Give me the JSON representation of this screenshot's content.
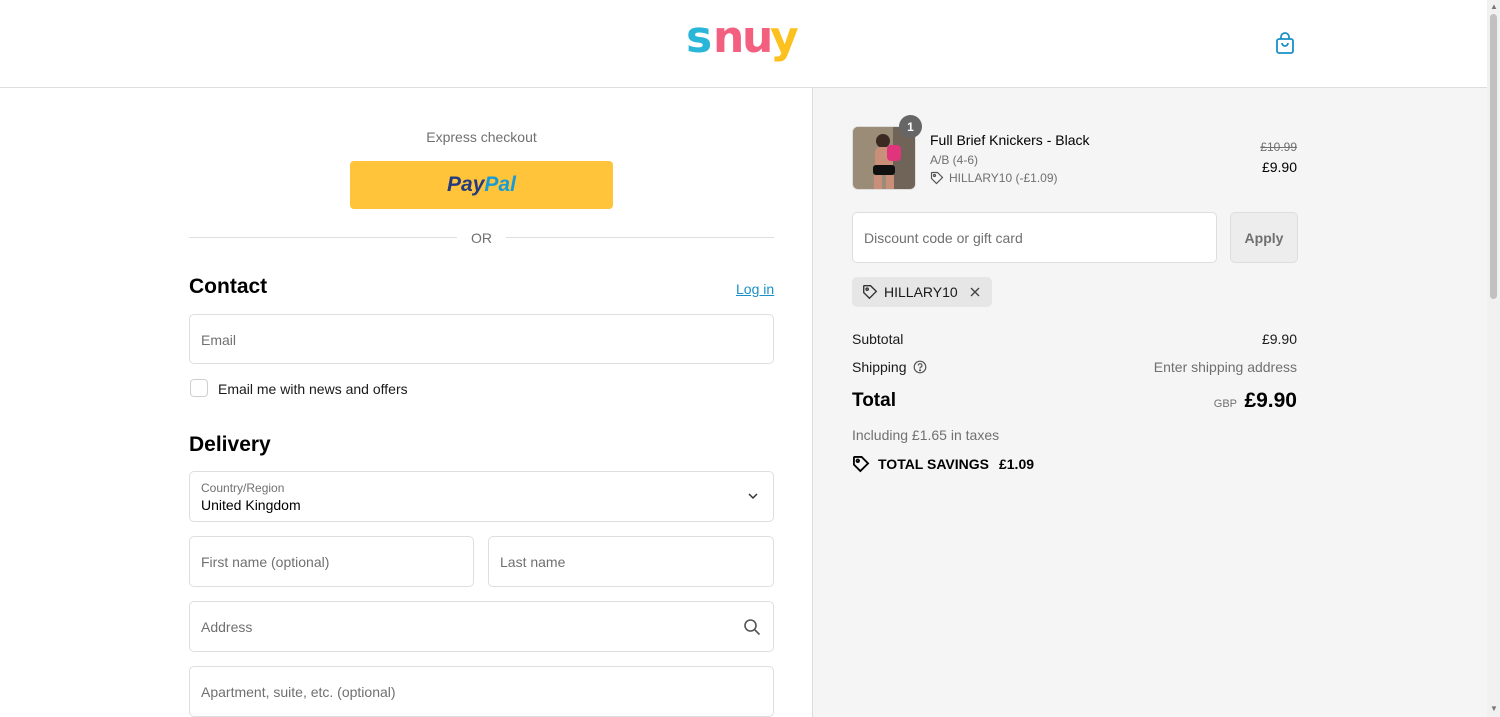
{
  "header": {
    "logo_text": "snuy",
    "logo_colors": [
      "#29b6d8",
      "#f25f7f",
      "#fdc11f"
    ],
    "cart_icon": "shopping-bag-icon"
  },
  "express": {
    "label": "Express checkout",
    "paypal_pay": "Pay",
    "paypal_pal": "Pal",
    "or_text": "OR"
  },
  "contact": {
    "title": "Contact",
    "login_link": "Log in",
    "email_placeholder": "Email",
    "newsletter_label": "Email me with news and offers"
  },
  "delivery": {
    "title": "Delivery",
    "country_label": "Country/Region",
    "country_value": "United Kingdom",
    "first_name_placeholder": "First name (optional)",
    "last_name_placeholder": "Last name",
    "address_placeholder": "Address",
    "apartment_placeholder": "Apartment, suite, etc. (optional)"
  },
  "summary": {
    "product": {
      "quantity": "1",
      "name": "Full Brief Knickers - Black",
      "variant": "A/B (4-6)",
      "discount": "HILLARY10 (-£1.09)",
      "price_original": "£10.99",
      "price_current": "£9.90"
    },
    "discount_placeholder": "Discount code or gift card",
    "apply_label": "Apply",
    "applied_code": "HILLARY10",
    "subtotal_label": "Subtotal",
    "subtotal_value": "£9.90",
    "shipping_label": "Shipping",
    "shipping_value": "Enter shipping address",
    "total_label": "Total",
    "currency": "GBP",
    "total_value": "£9.90",
    "tax_note": "Including £1.65 in taxes",
    "savings_label": "TOTAL SAVINGS",
    "savings_value": "£1.09"
  }
}
